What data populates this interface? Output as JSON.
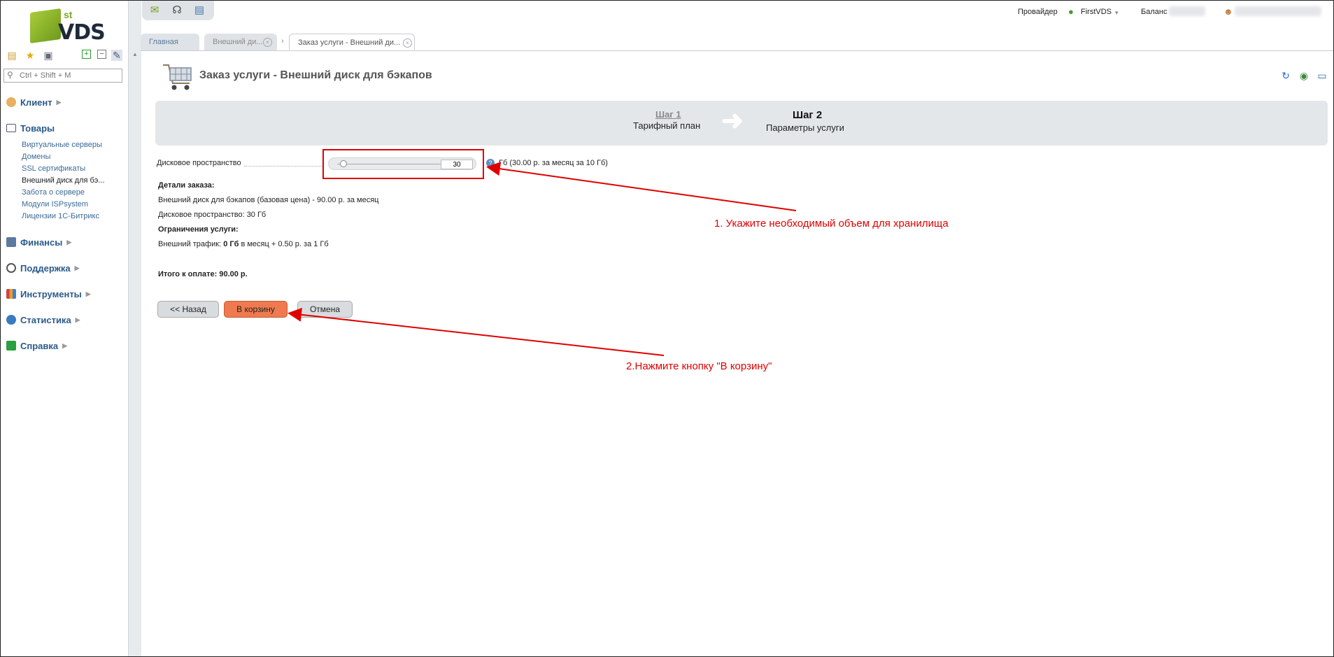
{
  "logo": {
    "sup": "st",
    "brand": "VDS"
  },
  "search": {
    "placeholder": "Ctrl + Shift + M"
  },
  "menu": {
    "client": "Клиент",
    "products": "Товары",
    "products_items": [
      "Виртуальные серверы",
      "Домены",
      "SSL сертификаты",
      "Внешний диск для бэ...",
      "Забота о сервере",
      "Модули ISPsystem",
      "Лицензии 1С-Битрикс"
    ],
    "finance": "Финансы",
    "support": "Поддержка",
    "tools": "Инструменты",
    "stats": "Статистика",
    "help": "Справка"
  },
  "topbar": {
    "provider_label": "Провайдер",
    "provider_value": "FirstVDS",
    "balance_label": "Баланс"
  },
  "tabs": [
    "Главная",
    "Внешний ди...",
    "Заказ услуги - Внешний ди..."
  ],
  "page": {
    "title": "Заказ услуги - Внешний диск для бэкапов",
    "step1_num": "Шаг 1",
    "step1_desc": "Тарифный план",
    "step2_num": "Шаг 2",
    "step2_desc": "Параметры услуги",
    "disk_label": "Дисковое пространство",
    "disk_value": "30",
    "slider_level": 0.05,
    "price_note": "Гб (30.00 р. за месяц за 10 Гб)",
    "details_heading": "Детали заказа:",
    "detail_line1": "Внешний диск для бэкапов (базовая цена) - 90.00 р. за месяц",
    "detail_line2": "Дисковое пространство: 30 Гб",
    "limits_heading": "Ограничения услуги:",
    "traffic_prefix": "Внешний трафик:",
    "traffic_value": "0 Гб",
    "traffic_suffix": "в месяц + 0.50 р. за 1 Гб",
    "total": "Итого к оплате: 90.00 р."
  },
  "buttons": {
    "back": "<< Назад",
    "cart": "В корзину",
    "cancel": "Отмена"
  },
  "annotations": {
    "step1": "1.  Укажите необходимый объем для хранилища",
    "step2": "2.Нажмите кнопку \"В корзину\""
  },
  "colors": {
    "accent": "#f07a50",
    "annotation": "#e00000",
    "link": "#2a5a8a"
  }
}
